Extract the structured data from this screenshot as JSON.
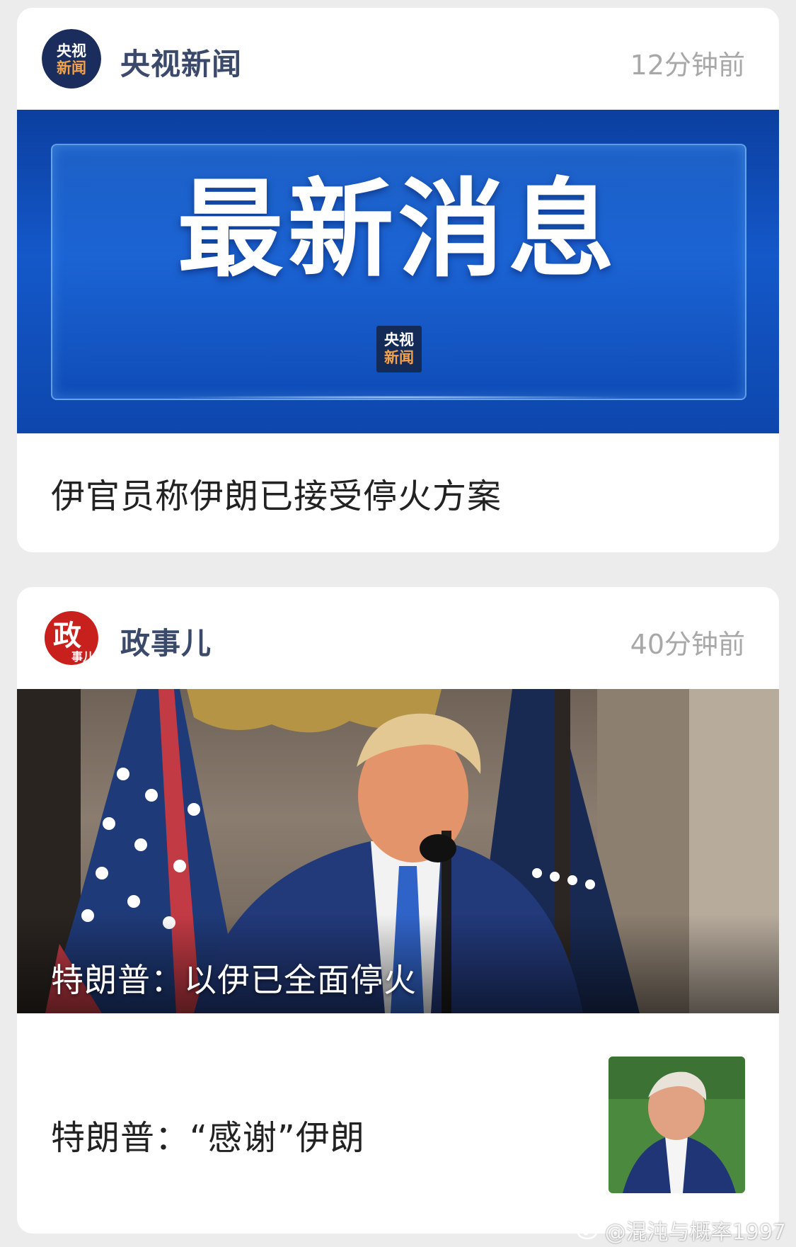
{
  "feed": [
    {
      "source": "央视新闻",
      "avatar_text": [
        "央视",
        "新闻"
      ],
      "time": "12分钟前",
      "banner": {
        "title": "最新消息",
        "logo_text": [
          "央视",
          "新闻"
        ]
      },
      "headline": "伊官员称伊朗已接受停火方案"
    },
    {
      "source": "政事儿",
      "avatar_text": [
        "政",
        "事儿"
      ],
      "time": "40分钟前",
      "photo_caption": "特朗普：以伊已全面停火",
      "headline": "特朗普：“感谢”伊朗"
    }
  ],
  "watermark": "@混沌与概率1997",
  "colors": {
    "source_name": "#3b4a6b",
    "timestamp": "#a8a8a8",
    "banner_blue": "#1458c9",
    "cctv_orange": "#f3a24a",
    "zhengshier_red": "#c8201d"
  },
  "icons": {
    "weibo": "weibo-icon"
  }
}
